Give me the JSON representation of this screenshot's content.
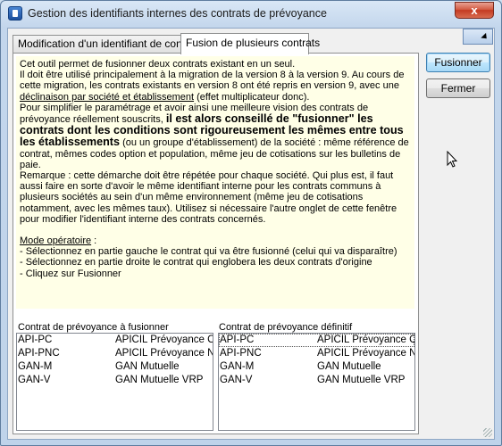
{
  "window": {
    "title": "Gestion des identifiants internes des contrats de prévoyance",
    "close_label": "x"
  },
  "tabs": [
    {
      "label": "Modification d'un identifiant de contrat"
    },
    {
      "label": "Fusion de plusieurs contrats"
    }
  ],
  "description": {
    "p1": "Cet outil permet de fusionner deux contrats existant en un seul.",
    "p2a": "Il doit être utilisé principalement à la migration de la version 8 à la version 9. Au cours de cette migration, les contrats existants en version 8 ont été repris en version 9, avec une ",
    "p2_link": "déclinaison par société et établissement",
    "p2b": " (effet multiplicateur donc).",
    "p3a": "Pour simplifier le paramétrage et avoir ainsi une meilleure vision des contrats de prévoyance réellement souscrits, ",
    "p3_bold": "il est alors conseillé de \"fusionner\" les contrats dont les conditions sont rigoureusement les mêmes entre tous les établissements",
    "p3b": "  (ou un groupe d'établissement) de la société : même référence de contrat, mêmes codes option et population, même jeu de cotisations sur les bulletins de paie.",
    "p4": "Remarque : cette démarche doit être répétée pour chaque société. Qui plus est, il faut aussi faire en sorte d'avoir le même identifiant interne pour les contrats communs à plusieurs sociétés au sein d'un même environnement (même jeu de cotisations notamment, avec les mêmes taux). Utilisez si nécessaire l'autre onglet de cette fenêtre pour modifier l'identifiant interne des contrats concernés.",
    "mode_title": "Mode opératoire",
    "mode_colon": " :",
    "steps": [
      "- Sélectionnez en partie gauche le contrat qui va être fusionné (celui qui va disparaître)",
      "- Sélectionnez en partie droite le contrat qui englobera les deux contrats d'origine",
      "- Cliquez sur Fusionner"
    ]
  },
  "left_list": {
    "label": "Contrat de prévoyance à fusionner",
    "rows": [
      {
        "code": "API-PC",
        "name": "APICIL Prévoyance Ca"
      },
      {
        "code": "API-PNC",
        "name": "APICIL Prévoyance No"
      },
      {
        "code": "GAN-M",
        "name": "GAN Mutuelle"
      },
      {
        "code": "GAN-V",
        "name": "GAN Mutuelle VRP"
      }
    ]
  },
  "right_list": {
    "label": "Contrat de prévoyance définitif",
    "rows": [
      {
        "code": "API-PC",
        "name": "APICIL Prévoyance Ca"
      },
      {
        "code": "API-PNC",
        "name": "APICIL Prévoyance No"
      },
      {
        "code": "GAN-M",
        "name": "GAN Mutuelle"
      },
      {
        "code": "GAN-V",
        "name": "GAN Mutuelle VRP"
      }
    ]
  },
  "buttons": {
    "merge": "Fusionner",
    "close": "Fermer"
  }
}
